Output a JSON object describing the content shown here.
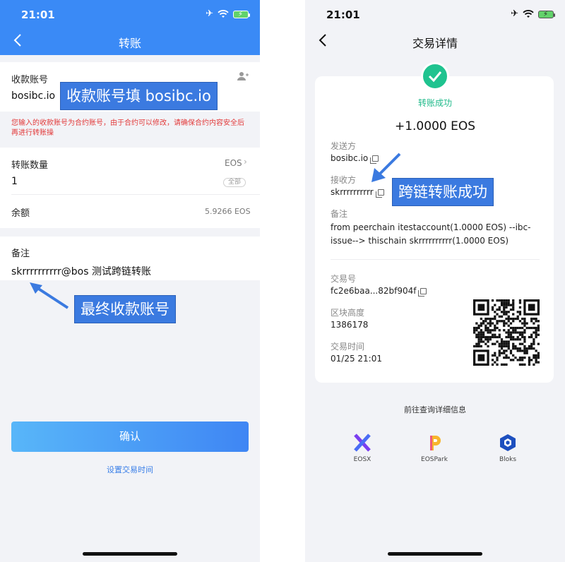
{
  "left": {
    "status": {
      "time": "21:01"
    },
    "title": "转账",
    "receiver": {
      "label": "收款账号",
      "value": "bosibc.io"
    },
    "hint": "您输入的收款账号为合约账号，由于合约可以修改，请确保合约内容安全后再进行转账操",
    "amount": {
      "label": "转账数量",
      "token": "EOS",
      "value": "1",
      "all_label": "全部"
    },
    "balance": {
      "label": "余额",
      "value": "5.9266 EOS"
    },
    "memo": {
      "label": "备注",
      "value": "skrrrrrrrrrr@bos 测试跨链转账"
    },
    "confirm_label": "确认",
    "set_time_label": "设置交易时间",
    "annotations": {
      "receiver": "收款账号填 bosibc.io",
      "final": "最终收款账号"
    }
  },
  "right": {
    "status": {
      "time": "21:01"
    },
    "title": "交易详情",
    "success_text": "转账成功",
    "amount": "+1.0000 EOS",
    "sender": {
      "label": "发送方",
      "value": "bosibc.io"
    },
    "receiver": {
      "label": "接收方",
      "value": "skrrrrrrrrrr"
    },
    "memo": {
      "label": "备注",
      "value": "from peerchain itestaccount(1.0000 EOS) --ibc-issue--> thischain skrrrrrrrrrr(1.0000 EOS)"
    },
    "txid": {
      "label": "交易号",
      "value": "fc2e6baa...82bf904f"
    },
    "block": {
      "label": "区块高度",
      "value": "1386178"
    },
    "time": {
      "label": "交易时间",
      "value": "01/25 21:01"
    },
    "explorer_title": "前往查询详细信息",
    "explorers": [
      {
        "name": "EOSX"
      },
      {
        "name": "EOSPark"
      },
      {
        "name": "Bloks"
      }
    ],
    "annotation": "跨链转账成功"
  },
  "colors": {
    "primary_blue": "#3a8af6",
    "success_green": "#1fc38f",
    "warning_red": "#e23a3a",
    "annotation_blue": "#3b7ae0"
  }
}
